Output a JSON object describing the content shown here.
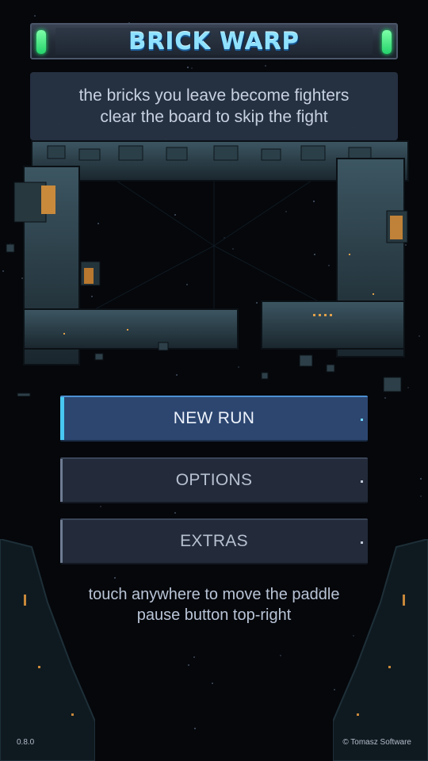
{
  "title": "BRICK WARP",
  "hint": {
    "line1": "the bricks you leave become fighters",
    "line2": "clear the board to skip the fight"
  },
  "menu": {
    "new_run": "NEW RUN",
    "options": "OPTIONS",
    "extras": "EXTRAS"
  },
  "controls_hint": {
    "line1": "touch anywhere to move the paddle",
    "line2": "pause button top-right"
  },
  "version": "0.8.0",
  "copyright": "© Tomasz Software",
  "colors": {
    "background": "#05070b",
    "primary_button": "#2c4670",
    "accent_cyan": "#48c8f2",
    "title_lights": "#29ff7a"
  }
}
